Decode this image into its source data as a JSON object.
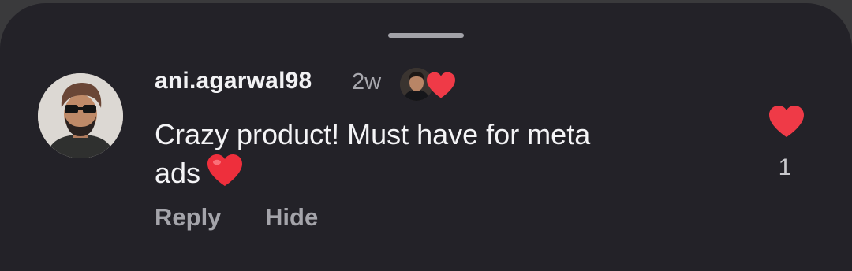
{
  "comment": {
    "username": "ani.agarwal98",
    "time": "2w",
    "text": "Crazy product! Must have for meta ads",
    "text_line1": "Crazy product! Must have for meta",
    "text_line2": "ads",
    "text_emoji": "red-heart",
    "creator_liked": true,
    "actions": {
      "reply_label": "Reply",
      "hide_label": "Hide"
    },
    "like_count": "1",
    "liked": true
  },
  "icons": {
    "like": "heart-icon",
    "creator_like": "heart-icon",
    "handle": "drag-handle"
  },
  "colors": {
    "background": "#232228",
    "heart": "#ef3a47",
    "primary_text": "#f2f2f4",
    "secondary_text": "#a4a4aa"
  }
}
